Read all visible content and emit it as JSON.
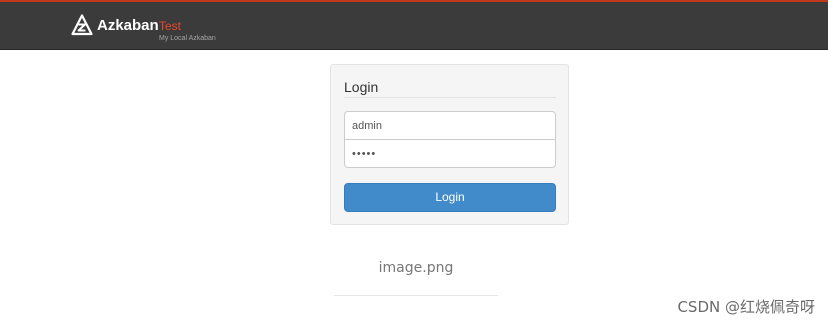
{
  "header": {
    "brand_name": "Azkaban",
    "environment": "Test",
    "subtitle": "My Local Azkaban",
    "logo_icon": "azkaban-logo-icon",
    "colors": {
      "bar_background": "#3b3b3b",
      "top_accent": "#c0391c",
      "environment_text": "#e8472b"
    }
  },
  "login": {
    "title": "Login",
    "username_value": "admin",
    "password_value": "•••••",
    "button_label": "Login",
    "colors": {
      "button": "#428bca",
      "panel": "#f5f5f5"
    }
  },
  "image_caption": "image.png",
  "watermark": "CSDN @红烧佩奇呀"
}
